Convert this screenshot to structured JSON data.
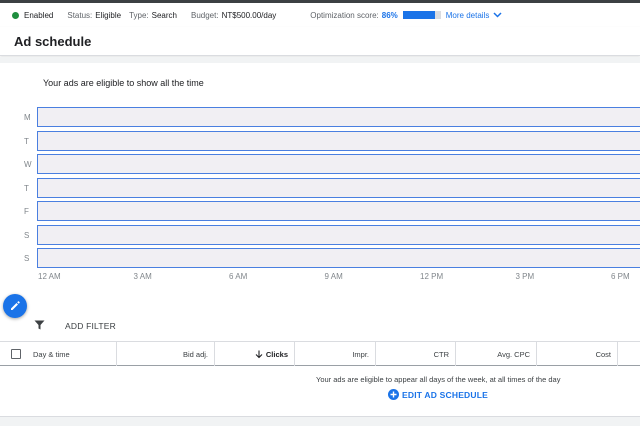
{
  "status_bar": {
    "enabled_label": "Enabled",
    "status_label": "Status:",
    "status_value": "Eligible",
    "type_label": "Type:",
    "type_value": "Search",
    "budget_label": "Budget:",
    "budget_value": "NT$500.00/day",
    "optimization_label": "Optimization score:",
    "optimization_value": "86%",
    "optimization_fraction": 0.86,
    "more_details": "More details",
    "enabled_color": "#1e8e3e",
    "accent_color": "#1a73e8"
  },
  "page": {
    "title": "Ad schedule"
  },
  "schedule": {
    "message": "Your ads are eligible to show all the time",
    "days": [
      "M",
      "T",
      "W",
      "T",
      "F",
      "S",
      "S"
    ],
    "hours": [
      "12 AM",
      "3 AM",
      "6 AM",
      "9 AM",
      "12 PM",
      "3 PM",
      "6 PM"
    ]
  },
  "toolbar": {
    "edit_icon": "pencil-icon",
    "filter_icon": "filter-icon",
    "add_filter": "ADD FILTER"
  },
  "table": {
    "columns": [
      "Day & time",
      "Bid adj.",
      "Clicks",
      "Impr.",
      "CTR",
      "Avg. CPC",
      "Cost"
    ],
    "sort_column": "Clicks",
    "sort_direction": "descending",
    "empty_message": "Your ads are eligible to appear all days of the week, at all times of the day",
    "edit_action": "EDIT AD SCHEDULE"
  }
}
